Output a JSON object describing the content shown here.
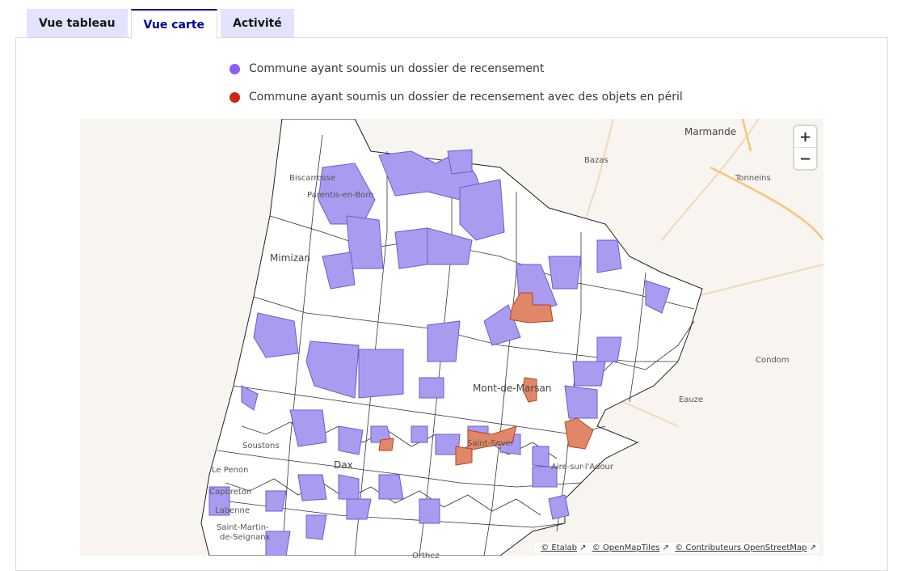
{
  "tabs": [
    {
      "label": "Vue tableau",
      "active": false
    },
    {
      "label": "Vue carte",
      "active": true
    },
    {
      "label": "Activité",
      "active": false
    }
  ],
  "legend": [
    {
      "label": "Commune ayant soumis un dossier de recensement",
      "color": "#8b5cf6"
    },
    {
      "label": "Commune ayant soumis un dossier de recensement avec des objets en péril",
      "color": "#c8290f"
    }
  ],
  "map": {
    "zoom_in": "+",
    "zoom_out": "−",
    "fill_submitted": "#a99cf0",
    "fill_peril": "#e0876a",
    "attribution": [
      "© Etalab",
      "© OpenMapTiles",
      "© Contributeurs OpenStreetMap"
    ],
    "places": {
      "marmande": "Marmande",
      "bazas": "Bazas",
      "tonneins": "Tonneins",
      "biscarrosse": "Biscarrosse",
      "parentis": "Parentis-en-Born",
      "mimizan": "Mimizan",
      "condom": "Condom",
      "eauze": "Eauze",
      "mont_de_marsan": "Mont-de-Marsan",
      "soustons": "Soustons",
      "le_penon": "Le Penon",
      "capbreton": "Capbreton",
      "labenne": "Labenne",
      "saint_martin": "Saint-Martin-",
      "de_seignanx": "de-Seignanx",
      "dax": "Dax",
      "saint_sever": "Saint-Sever",
      "aire_sur_adour": "Aire-sur-l'Adour",
      "orthez": "Orthez"
    }
  }
}
